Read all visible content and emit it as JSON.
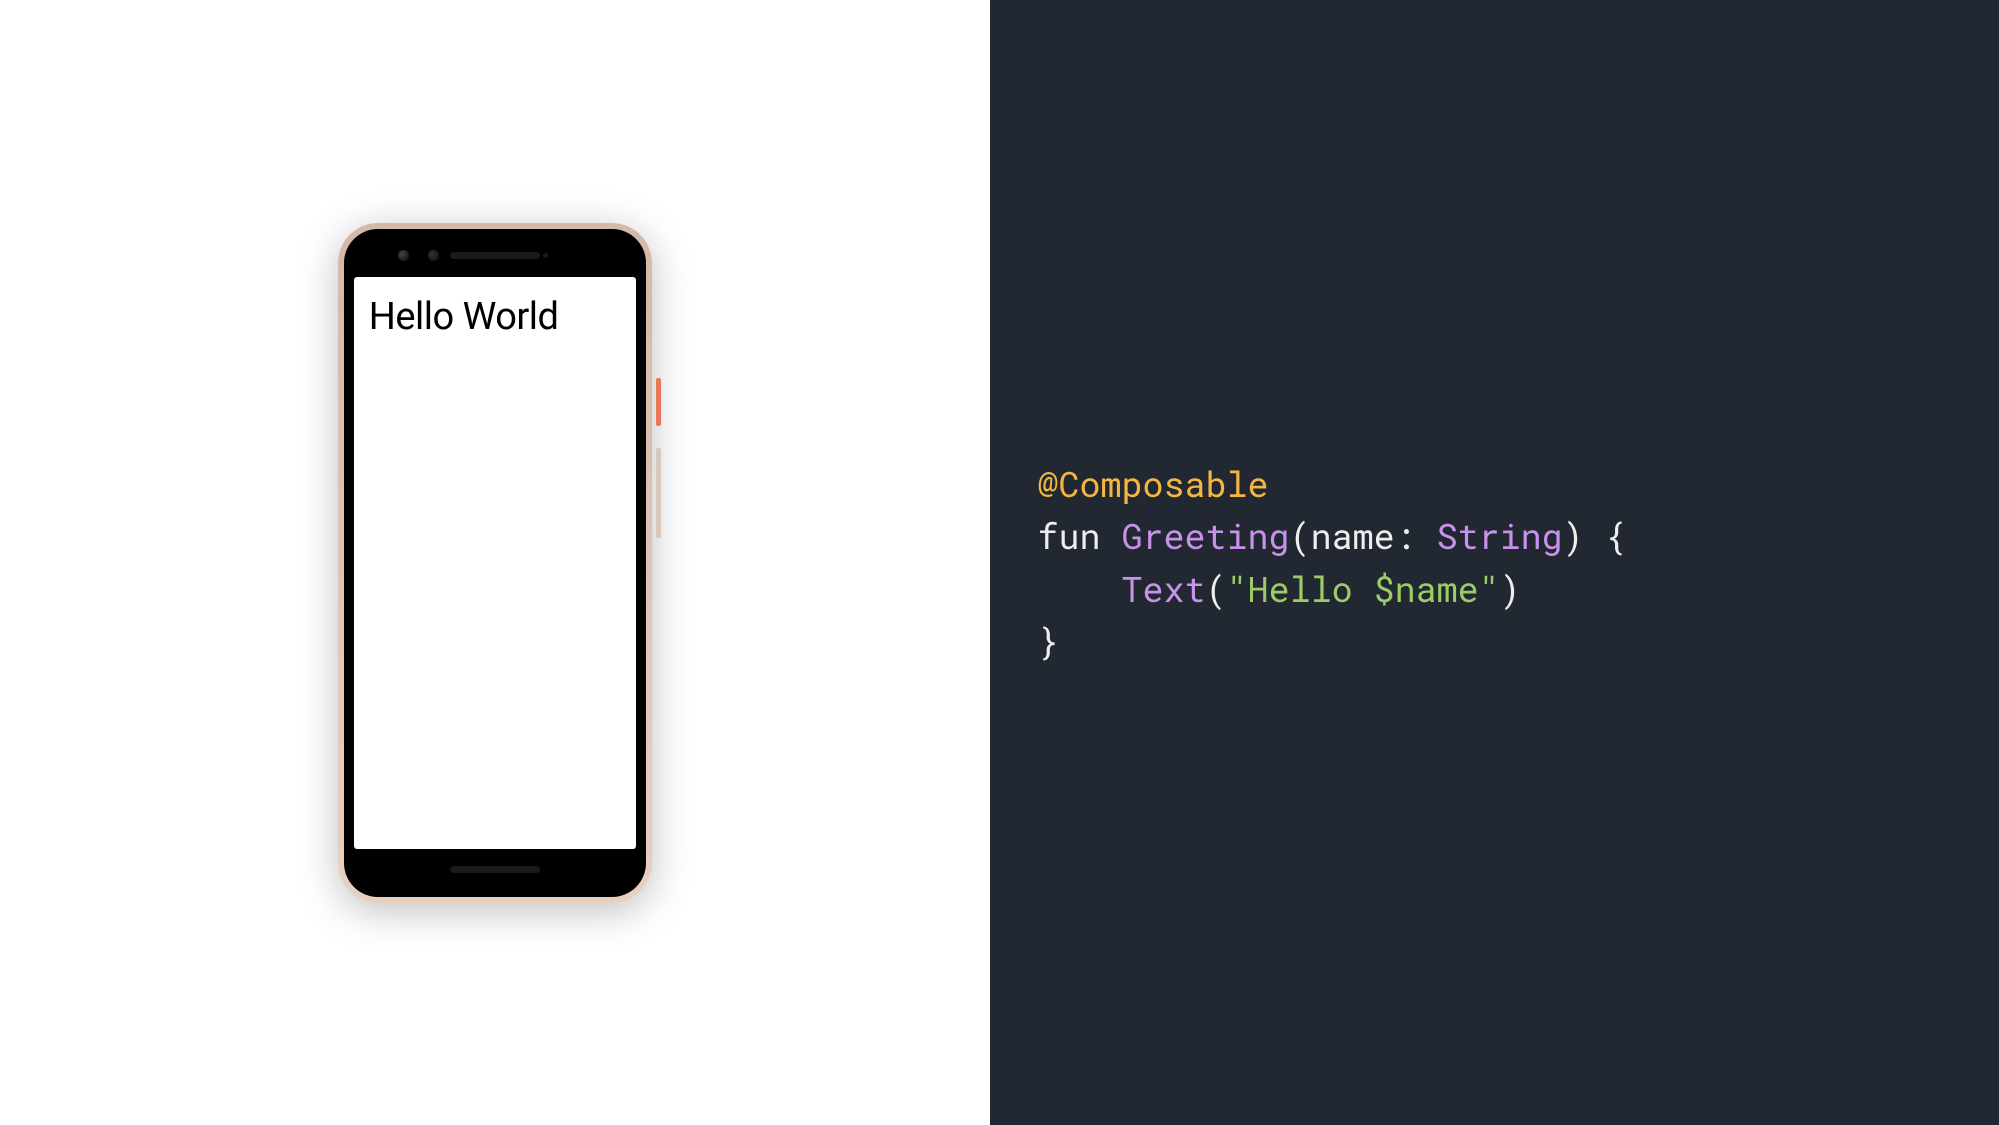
{
  "phone": {
    "screen_text": "Hello World"
  },
  "code": {
    "annotation": "@Composable",
    "fun_keyword": "fun",
    "function_name": "Greeting",
    "paren_open": "(",
    "param_name": "name",
    "colon": ":",
    "param_type": "String",
    "paren_close": ")",
    "brace_open": "{",
    "text_fn": "Text",
    "call_open": "(",
    "str_open": "\"",
    "str_part1": "Hello ",
    "interp": "$name",
    "str_close": "\"",
    "call_close": ")",
    "brace_close": "}",
    "indent": "    "
  }
}
